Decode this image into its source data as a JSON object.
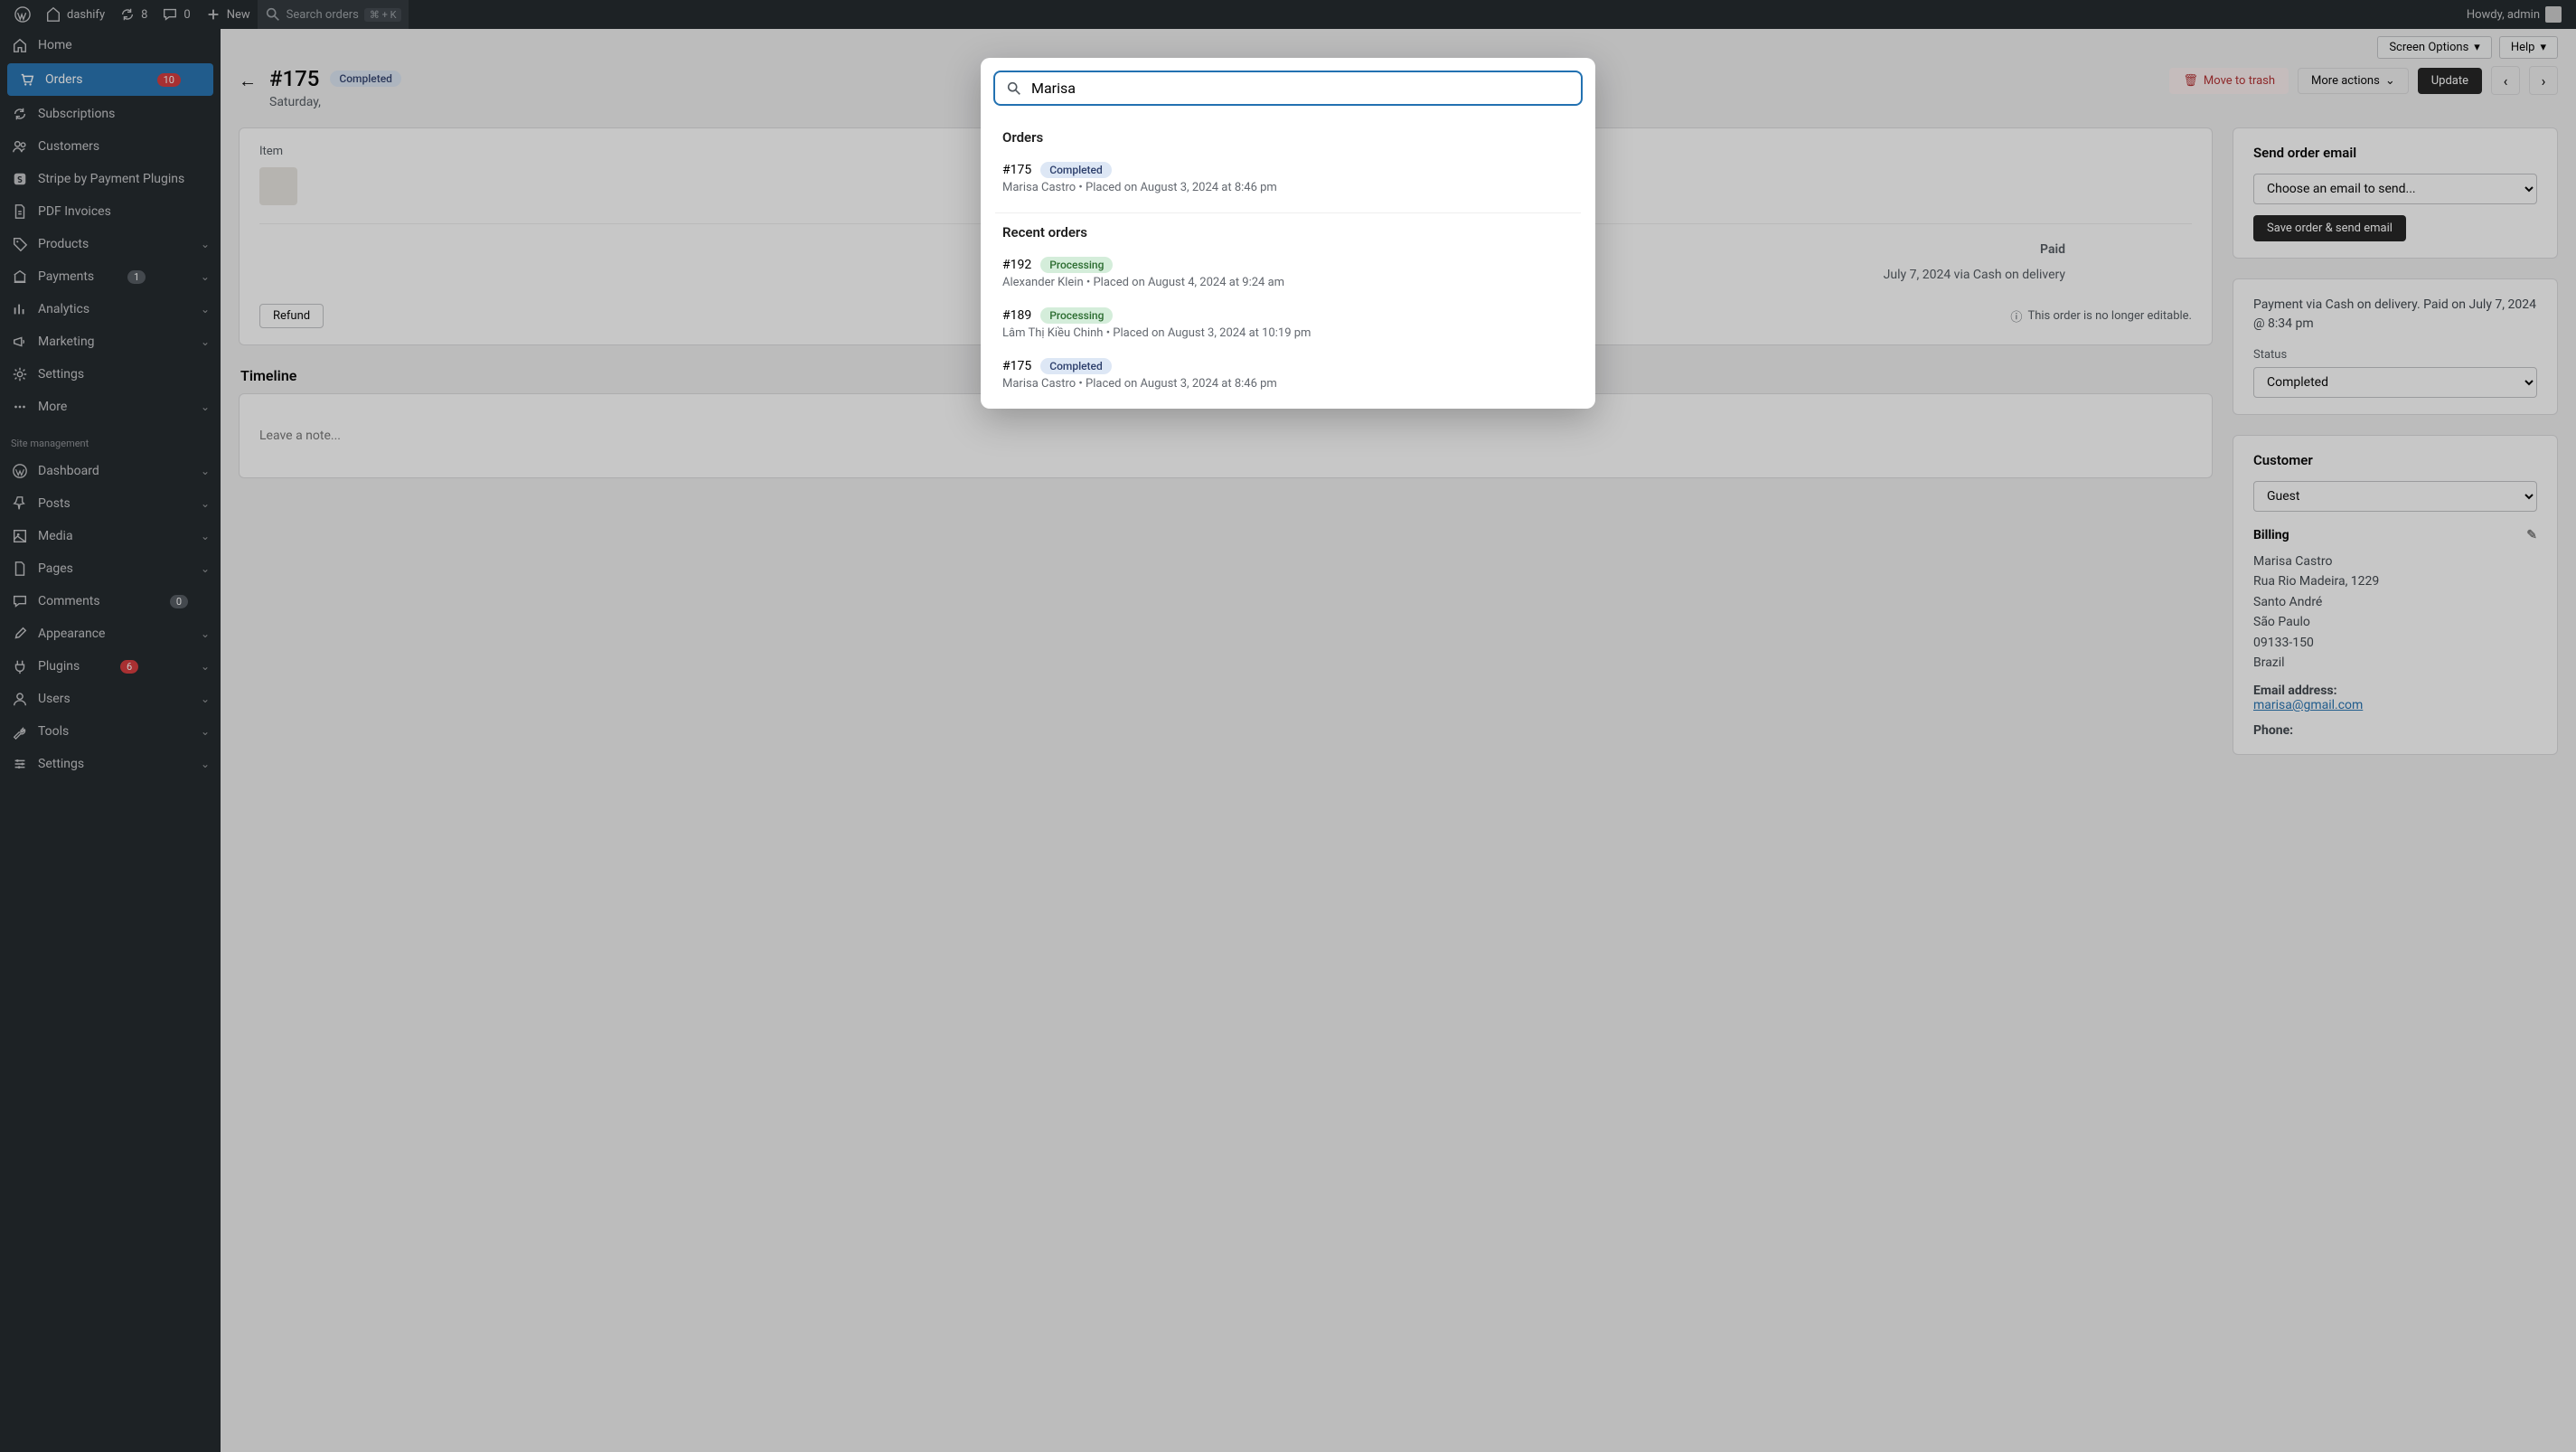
{
  "admin_bar": {
    "site_name": "dashify",
    "updates_count": "8",
    "comments_count": "0",
    "new_label": "New",
    "search_label": "Search orders",
    "search_shortcut": "⌘ + K",
    "howdy": "Howdy, admin"
  },
  "sidebar": {
    "items_top": [
      {
        "icon": "home",
        "label": "Home"
      },
      {
        "icon": "cart",
        "label": "Orders",
        "badge": "10",
        "active": true
      },
      {
        "icon": "refresh",
        "label": "Subscriptions"
      },
      {
        "icon": "users",
        "label": "Customers"
      },
      {
        "icon": "stripe",
        "label": "Stripe by Payment Plugins"
      },
      {
        "icon": "doc",
        "label": "PDF Invoices"
      },
      {
        "icon": "tag",
        "label": "Products",
        "chevron": true
      },
      {
        "icon": "bank",
        "label": "Payments",
        "badge": "1",
        "badge_gray": true,
        "chevron": true
      },
      {
        "icon": "chart",
        "label": "Analytics",
        "chevron": true
      },
      {
        "icon": "megaphone",
        "label": "Marketing",
        "chevron": true
      },
      {
        "icon": "gear",
        "label": "Settings"
      },
      {
        "icon": "dots",
        "label": "More",
        "chevron": true
      }
    ],
    "heading": "Site management",
    "items_bottom": [
      {
        "icon": "wp",
        "label": "Dashboard",
        "chevron": true
      },
      {
        "icon": "pin",
        "label": "Posts",
        "chevron": true
      },
      {
        "icon": "media",
        "label": "Media",
        "chevron": true
      },
      {
        "icon": "page",
        "label": "Pages",
        "chevron": true
      },
      {
        "icon": "comment",
        "label": "Comments",
        "badge": "0",
        "badge_gray": true
      },
      {
        "icon": "brush",
        "label": "Appearance",
        "chevron": true
      },
      {
        "icon": "plug",
        "label": "Plugins",
        "badge": "6",
        "chevron": true
      },
      {
        "icon": "user",
        "label": "Users",
        "chevron": true
      },
      {
        "icon": "wrench",
        "label": "Tools",
        "chevron": true
      },
      {
        "icon": "sliders",
        "label": "Settings",
        "chevron": true
      }
    ]
  },
  "screen_opts": {
    "screen": "Screen Options",
    "help": "Help"
  },
  "order": {
    "id": "#175",
    "status": "Completed",
    "date_line": "Saturday,",
    "trash": "Move to trash",
    "more": "More actions",
    "update": "Update"
  },
  "items_card": {
    "head": {
      "item": "Item"
    },
    "refund": "Refund",
    "not_editable": "This order is no longer editable.",
    "paid_label": "Paid",
    "paid_amount": "",
    "paid_sub": "July 7, 2024 via Cash on delivery"
  },
  "timeline": {
    "heading": "Timeline",
    "placeholder": "Leave a note..."
  },
  "email_card": {
    "heading": "Send order email",
    "placeholder": "Choose an email to send...",
    "button": "Save order & send email"
  },
  "summary_card": {
    "note": "Payment via Cash on delivery. Paid on July 7, 2024 @ 8:34 pm",
    "status_label": "Status",
    "status_value": "Completed"
  },
  "customer_card": {
    "heading": "Customer",
    "select_value": "Guest",
    "billing_heading": "Billing",
    "name": "Marisa Castro",
    "street": "Rua Rio Madeira, 1229",
    "city": "Santo André",
    "state": "São Paulo",
    "zip": "09133-150",
    "country": "Brazil",
    "email_label": "Email address:",
    "email": "marisa@gmail.com",
    "phone_label": "Phone:"
  },
  "search_modal": {
    "query": "Marisa",
    "groups": [
      {
        "title": "Orders",
        "results": [
          {
            "id": "#175",
            "status": "Completed",
            "status_class": "completed",
            "sub": "Marisa Castro • Placed on August 3, 2024 at 8:46 pm"
          }
        ]
      },
      {
        "title": "Recent orders",
        "results": [
          {
            "id": "#192",
            "status": "Processing",
            "status_class": "processing",
            "sub": "Alexander Klein • Placed on August 4, 2024 at 9:24 am"
          },
          {
            "id": "#189",
            "status": "Processing",
            "status_class": "processing",
            "sub": "Lâm Thị Kiều Chinh • Placed on August 3, 2024 at 10:19 pm"
          },
          {
            "id": "#175",
            "status": "Completed",
            "status_class": "completed",
            "sub": "Marisa Castro • Placed on August 3, 2024 at 8:46 pm"
          }
        ]
      }
    ]
  }
}
